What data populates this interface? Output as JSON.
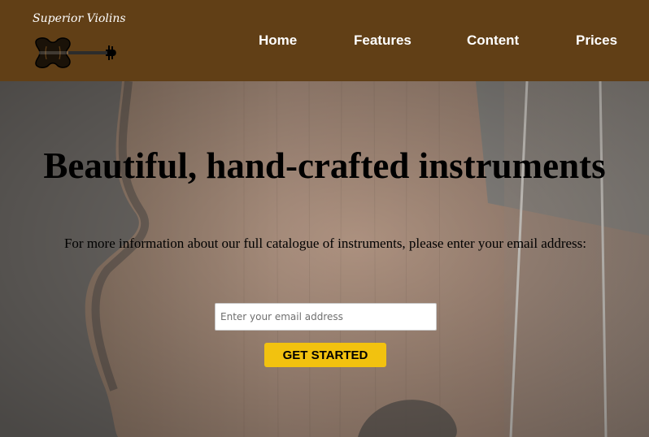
{
  "brand": {
    "name": "Superior Violins",
    "logo_icon": "violin-icon"
  },
  "nav": {
    "items": [
      {
        "label": "Home"
      },
      {
        "label": "Features"
      },
      {
        "label": "Content"
      },
      {
        "label": "Prices"
      }
    ]
  },
  "hero": {
    "title": "Beautiful, hand-crafted instruments",
    "text": "For more information about our full catalogue of instruments, please enter your email address:",
    "email_placeholder": "Enter your email address",
    "email_value": "",
    "cta_label": "GET STARTED"
  },
  "colors": {
    "header_bg": "#613f16",
    "accent": "#f2c20f",
    "hero_overlay": "#8e8b86"
  }
}
